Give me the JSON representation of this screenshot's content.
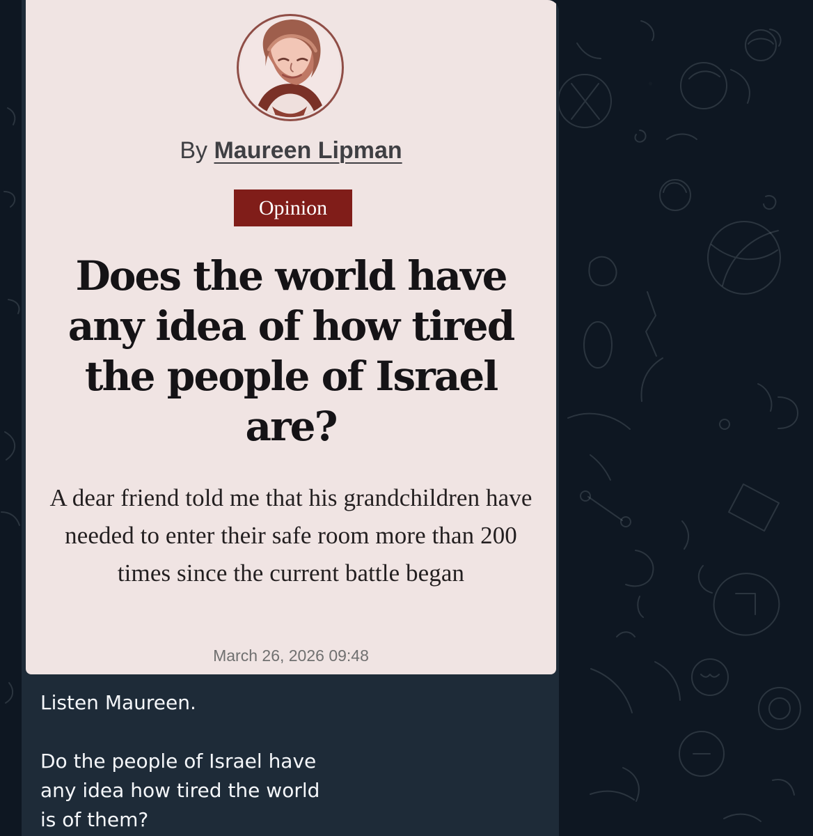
{
  "article": {
    "byline_prefix": "By",
    "author_name": "Maureen Lipman",
    "badge": "Opinion",
    "headline": "Does the world have any idea of how tired the people of Israel are?",
    "subheadline": "A dear friend told me that his grandchildren have needed to enter their safe room more than 200 times since the current battle began",
    "date": "March 26, 2026 09:48"
  },
  "message": {
    "line_1": "Listen Maureen.",
    "line_2": "Do the people of Israel have",
    "line_3": "any idea how tired the world",
    "line_4": "is of them?"
  },
  "colors": {
    "chat_background": "#0e1722",
    "bubble_background": "#1e2b38",
    "article_background": "#f0e4e3",
    "badge_background": "#801d19",
    "headline_text": "#151316",
    "message_text": "#f5f7fa"
  }
}
